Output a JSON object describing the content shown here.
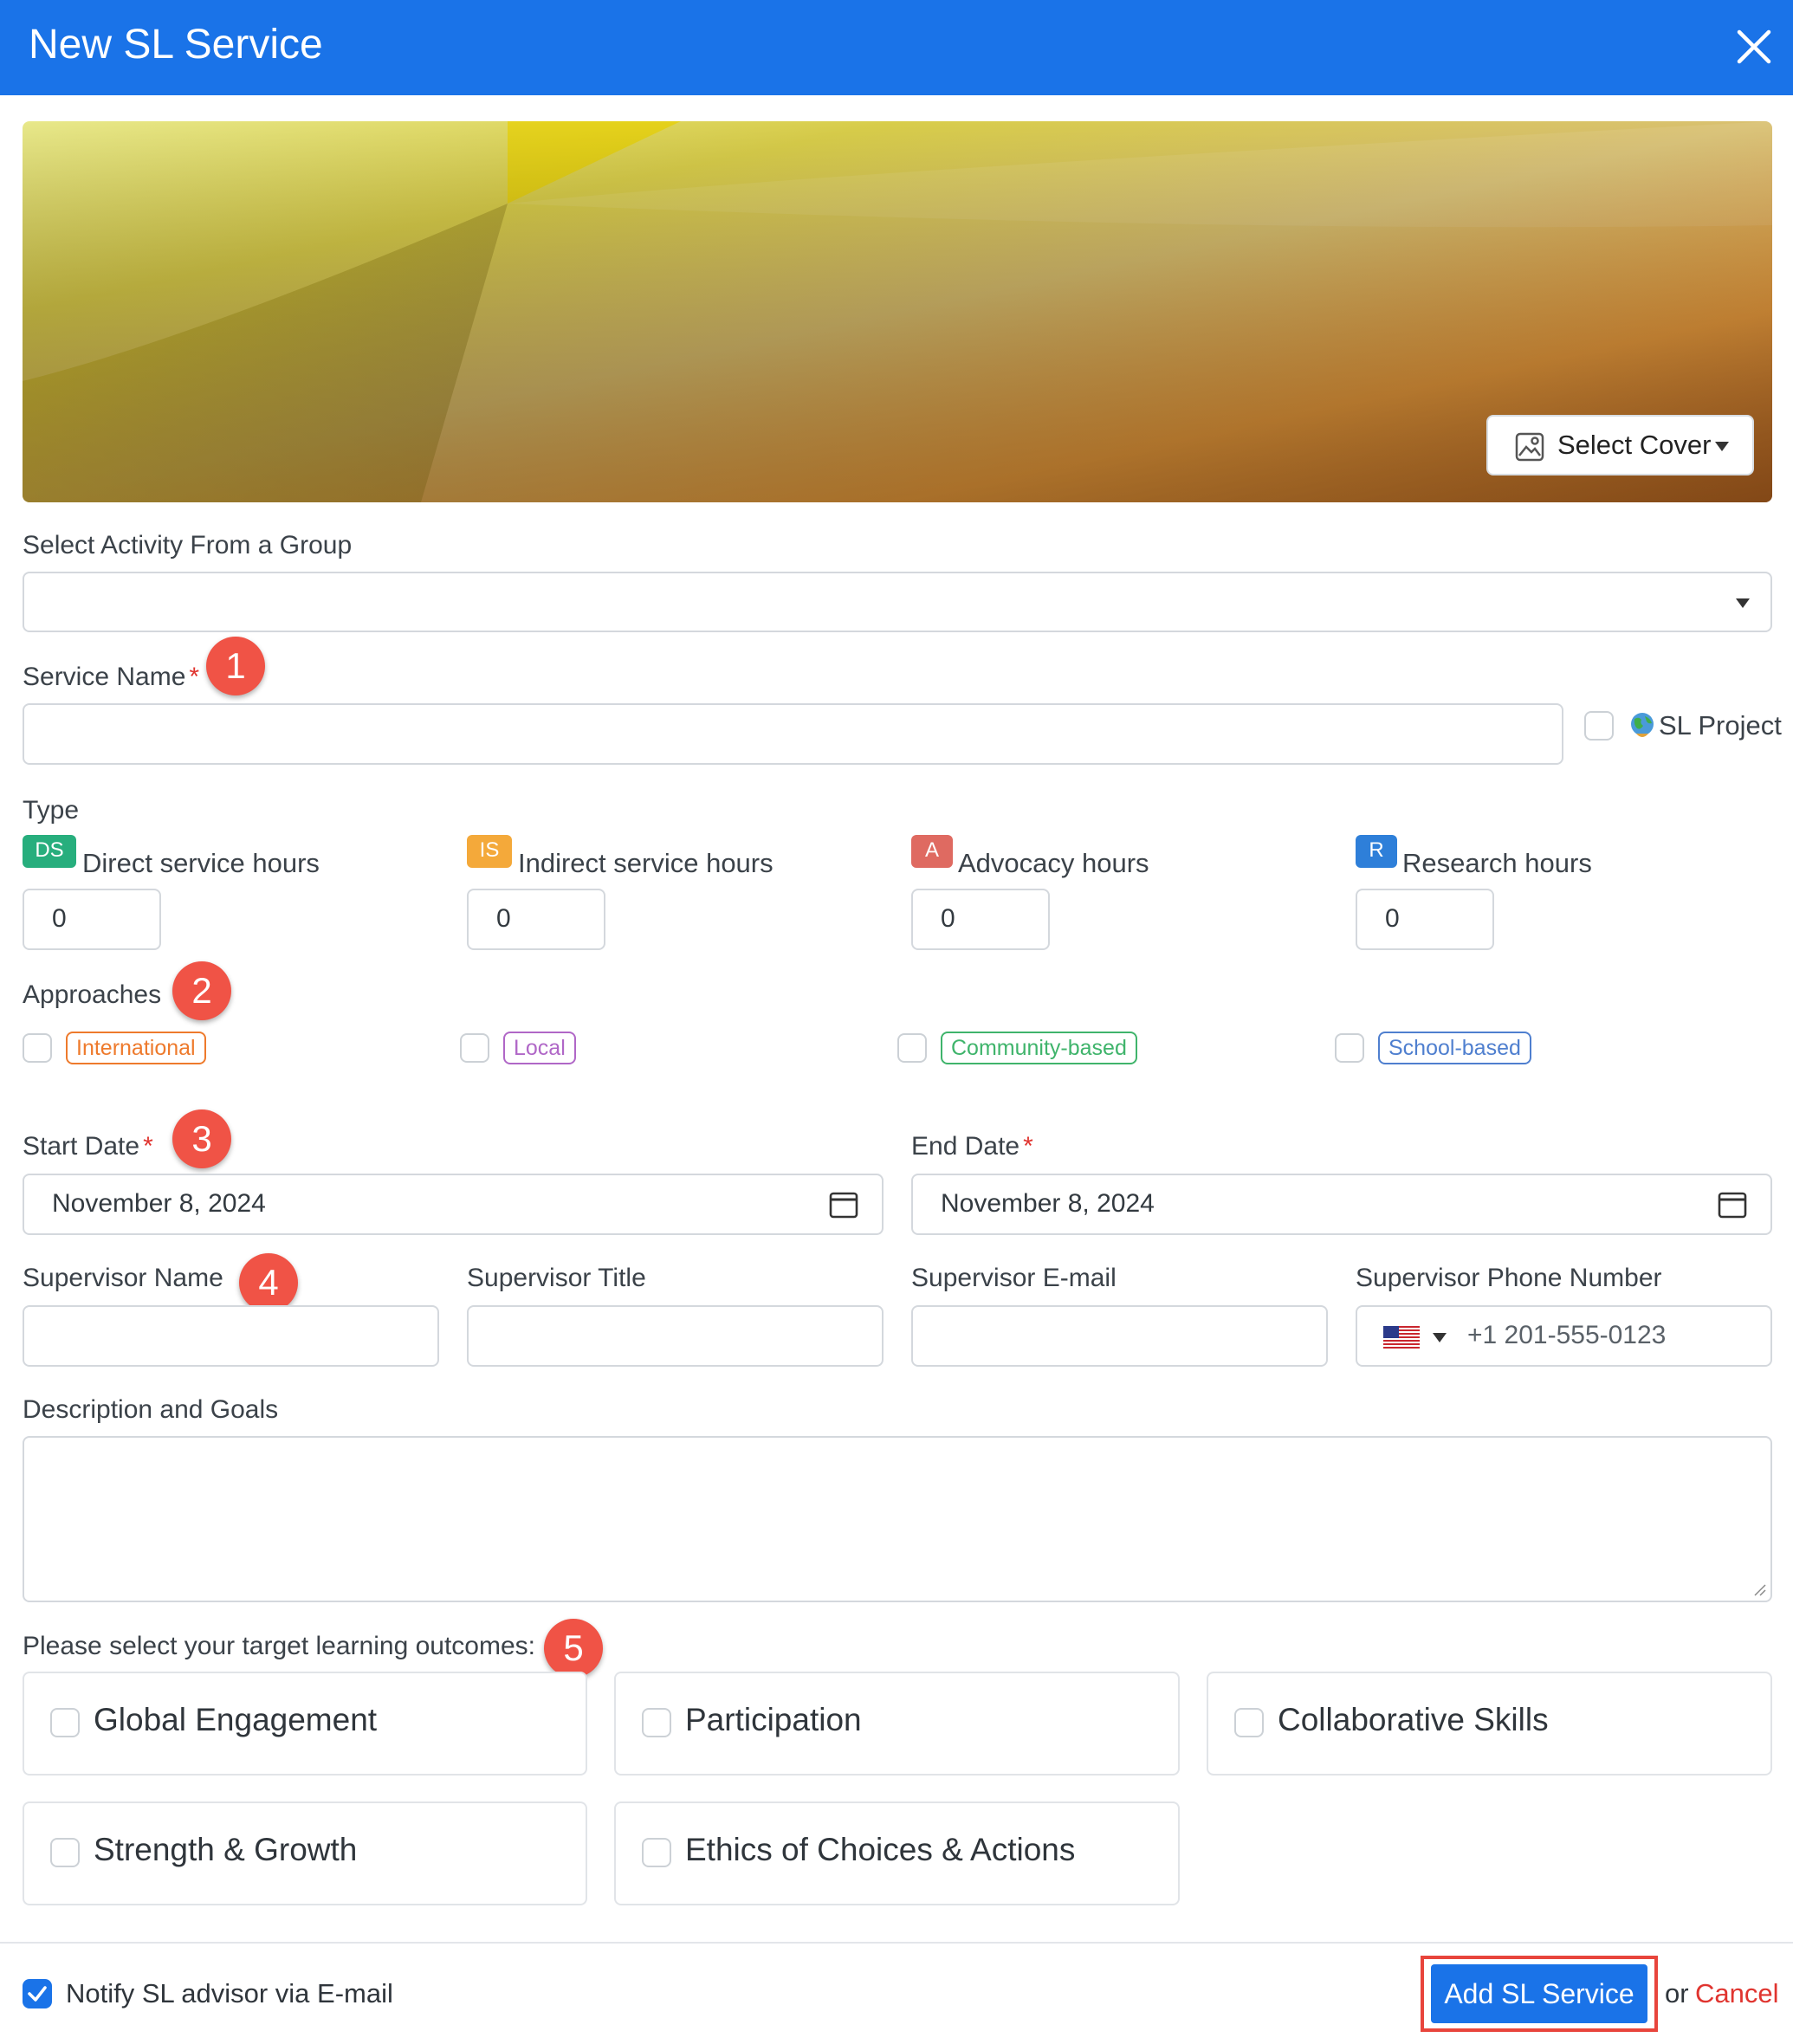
{
  "dialog": {
    "title": "New SL Service"
  },
  "cover": {
    "select_label": "Select Cover"
  },
  "activity": {
    "label": "Select Activity From a Group",
    "value": ""
  },
  "service_name": {
    "label": "Service Name",
    "required_mark": "*",
    "value": "",
    "sl_project_label": "SL Project"
  },
  "type": {
    "label": "Type",
    "items": [
      {
        "badge": "DS",
        "label": "Direct service hours",
        "value": "0",
        "color": "#27ae7d"
      },
      {
        "badge": "IS",
        "label": "Indirect service hours",
        "value": "0",
        "color": "#f4a93a"
      },
      {
        "badge": "A",
        "label": "Advocacy hours",
        "value": "0",
        "color": "#df6a61"
      },
      {
        "badge": "R",
        "label": "Research hours",
        "value": "0",
        "color": "#2e7fd9"
      }
    ]
  },
  "approaches": {
    "label": "Approaches",
    "items": [
      {
        "label": "International",
        "color": "#ee7a2c"
      },
      {
        "label": "Local",
        "color": "#b067c7"
      },
      {
        "label": "Community-based",
        "color": "#3fb46b"
      },
      {
        "label": "School-based",
        "color": "#4f7fcf"
      }
    ]
  },
  "dates": {
    "start_label": "Start Date",
    "start_value": "November 8, 2024",
    "end_label": "End Date",
    "end_value": "November 8, 2024",
    "required_mark": "*"
  },
  "supervisor": {
    "name_label": "Supervisor Name",
    "title_label": "Supervisor Title",
    "email_label": "Supervisor E-mail",
    "phone_label": "Supervisor Phone Number",
    "phone_placeholder": "+1 201-555-0123"
  },
  "description": {
    "label": "Description and Goals",
    "value": ""
  },
  "outcomes": {
    "label": "Please select your target learning outcomes:",
    "items": [
      "Global Engagement",
      "Participation",
      "Collaborative Skills",
      "Strength & Growth",
      "Ethics of Choices & Actions"
    ]
  },
  "markers": [
    "1",
    "2",
    "3",
    "4",
    "5"
  ],
  "footer": {
    "notify_label": "Notify SL advisor via E-mail",
    "notify_checked": true,
    "add_label": "Add SL Service",
    "or_text": "or",
    "cancel_label": "Cancel"
  },
  "colors": {
    "header": "#1a73e8",
    "accent": "#1a73e8",
    "required": "#e0342f",
    "marker": "#f05346",
    "cancel": "#e0342f"
  }
}
